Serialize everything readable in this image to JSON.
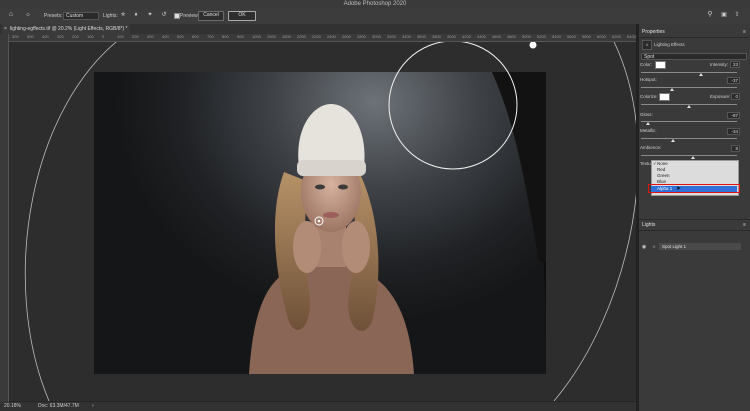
{
  "app_title": "Adobe Photoshop 2020",
  "options_bar": {
    "home_icon": "home-icon",
    "presets_label": "Presets:",
    "presets_value": "Custom",
    "lights_label": "Lights:",
    "preview_label": "Preview",
    "preview_checked": true,
    "cancel_label": "Cancel",
    "ok_label": "OK"
  },
  "document_tab": {
    "title": "lighting-egffects.tif @ 20.2% (Light Effects, RGB/8*) *"
  },
  "ruler_top_ticks": [
    "300",
    "500",
    "400",
    "300",
    "200",
    "100",
    "0",
    "100",
    "200",
    "300",
    "400",
    "500",
    "600",
    "700",
    "800",
    "900",
    "1000",
    "1500",
    "1800",
    "2000",
    "2200",
    "2400",
    "2600",
    "2800",
    "3000",
    "3200",
    "3400",
    "3600",
    "3800",
    "4000",
    "4200",
    "4400",
    "4600",
    "4800",
    "5000",
    "5200",
    "5400",
    "5600",
    "5800",
    "6000",
    "6200",
    "6400"
  ],
  "status_bar": {
    "zoom": "20.18%",
    "doc_info": "Doc: 63.3M/47.7M"
  },
  "properties_panel": {
    "title": "Properties",
    "section_title": "Lighting Effects",
    "light_type": "Spot",
    "color_label": "Color:",
    "intensity_label": "Intensity:",
    "intensity_value": "23",
    "intensity_fraction": 0.62,
    "hotspot_label": "Hotspot:",
    "hotspot_value": "-37",
    "hotspot_fraction": 0.32,
    "colorize_label": "Colorize:",
    "exposure_label": "Exposure:",
    "exposure_value": "0",
    "exposure_fraction": 0.5,
    "gloss_label": "Gloss:",
    "gloss_value": "-87",
    "gloss_fraction": 0.07,
    "metallic_label": "Metallic:",
    "metallic_value": "-34",
    "metallic_fraction": 0.33,
    "ambience_label": "Ambience:",
    "ambience_value": "8",
    "ambience_fraction": 0.54,
    "texture_label": "Texture:",
    "texture_options": [
      "None",
      "Red",
      "Green",
      "Blue",
      "Alpha 1"
    ],
    "texture_selected": "Alpha 1"
  },
  "lights_panel": {
    "title": "Lights",
    "item_label": "Spot Light 1"
  },
  "colors": {
    "accent_blue": "#2f6fd6",
    "highlight_red": "#e01313"
  }
}
